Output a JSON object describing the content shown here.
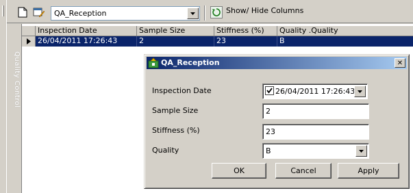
{
  "toolbar": {
    "view_selected": "QA_Reception",
    "show_hide_label": "Show/ Hide Columns"
  },
  "sidebar": {
    "tab_label": "Quality Control"
  },
  "grid": {
    "columns": [
      "Inspection Date",
      "Sample Size",
      "Stiffness (%)",
      "Quality .Quality"
    ],
    "rows": [
      [
        "26/04/2011 17:26:43",
        "2",
        "23",
        "B"
      ]
    ]
  },
  "dialog": {
    "title": "QA_Reception",
    "fields": {
      "inspection_date": {
        "label": "Inspection Date",
        "value": "26/04/2011 17:26:43",
        "checked": true
      },
      "sample_size": {
        "label": "Sample Size",
        "value": "2"
      },
      "stiffness": {
        "label": "Stiffness (%)",
        "value": "23"
      },
      "quality": {
        "label": "Quality",
        "value": "B"
      }
    },
    "buttons": {
      "ok": "OK",
      "cancel": "Cancel",
      "apply": "Apply"
    }
  },
  "colors": {
    "selection": "#0a246a",
    "face": "#d4d0c8",
    "title_gradient_end": "#a6caf0"
  }
}
